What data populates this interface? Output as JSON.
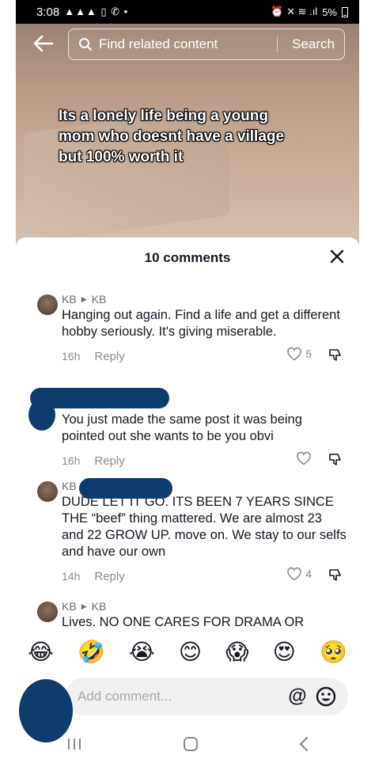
{
  "status_bar": {
    "time": "3:08",
    "left_icons": "▲▲▲ ▯ ✆ •",
    "right_icons": "⏰ ✕ ≋ .ıl",
    "battery": "5%"
  },
  "search": {
    "placeholder": "Find related content",
    "button": "Search"
  },
  "video": {
    "caption": "Its a lonely life being a young mom who doesnt have a village but 100% worth it"
  },
  "sheet": {
    "title": "10 comments"
  },
  "comments": [
    {
      "author": "KB",
      "reply_to": "KB",
      "text": "Hanging out again. Find a life and get a different hobby seriously. It's giving miserable.",
      "time": "16h",
      "reply": "Reply",
      "likes": "5"
    },
    {
      "author": "",
      "reply_to": "",
      "text": "You just made the same post it was being pointed out she wants to be you obvi",
      "time": "16h",
      "reply": "Reply",
      "likes": ""
    },
    {
      "author": "KB",
      "reply_to": "",
      "text": "DUDE LET IT GO. ITS BEEN 7 YEARS SINCE THE “beef” thing mattered. We are almost 23 and 22 GROW UP. move on. We stay to our selfs and have our own",
      "time": "14h",
      "reply": "Reply",
      "likes": "4"
    },
    {
      "author": "KB",
      "reply_to": "KB",
      "text": "Lives. NO ONE CARES FOR DRAMA OR",
      "time": "",
      "reply": "",
      "likes": ""
    }
  ],
  "emojis": [
    "😂",
    "🤣",
    "😭",
    "😊",
    "😱",
    "😍",
    "🥺"
  ],
  "add_comment": {
    "placeholder": "Add comment...",
    "mention": "@"
  },
  "colors": {
    "redaction": "#0e3c6e",
    "muted": "#8a8b91",
    "text": "#161823"
  }
}
